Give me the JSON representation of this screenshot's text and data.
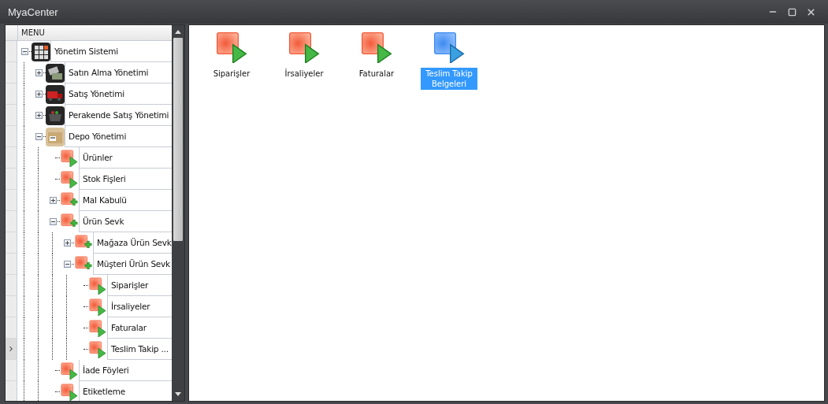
{
  "window": {
    "title": "MyaCenter"
  },
  "menu": {
    "header": "MENU",
    "items": [
      {
        "label": "Yönetim Sistemi",
        "kind": "grid",
        "expanded": true,
        "selected": false,
        "children": [
          {
            "label": "Satın Alma Yönetimi",
            "kind": "tags",
            "expanded": false,
            "selected": false
          },
          {
            "label": "Satış Yönetimi",
            "kind": "truck",
            "expanded": false,
            "selected": false
          },
          {
            "label": "Perakende Satış Yönetimi",
            "kind": "basket",
            "expanded": false,
            "selected": false
          },
          {
            "label": "Depo Yönetimi",
            "kind": "box",
            "expanded": true,
            "selected": false,
            "children": [
              {
                "label": "Ürünler",
                "kind": "play",
                "selected": false
              },
              {
                "label": "Stok Fişleri",
                "kind": "play",
                "selected": false
              },
              {
                "label": "Mal Kabulü",
                "kind": "plus",
                "expanded": false,
                "selected": false
              },
              {
                "label": "Ürün Sevk",
                "kind": "plus",
                "expanded": true,
                "selected": false,
                "children": [
                  {
                    "label": "Mağaza Ürün Sevk",
                    "kind": "plus",
                    "expanded": false,
                    "selected": false
                  },
                  {
                    "label": "Müşteri Ürün Sevk",
                    "kind": "plus",
                    "expanded": true,
                    "selected": false,
                    "children": [
                      {
                        "label": "Siparişler",
                        "kind": "play",
                        "selected": false
                      },
                      {
                        "label": "İrsaliyeler",
                        "kind": "play",
                        "selected": false
                      },
                      {
                        "label": "Faturalar",
                        "kind": "play",
                        "selected": false
                      },
                      {
                        "label": "Teslim Takip ...",
                        "kind": "play",
                        "selected": true
                      }
                    ]
                  }
                ]
              },
              {
                "label": "İade Föyleri",
                "kind": "play",
                "selected": false
              },
              {
                "label": "Etiketleme",
                "kind": "play",
                "selected": false
              }
            ]
          }
        ]
      }
    ]
  },
  "tiles": [
    {
      "label": "Siparişler",
      "selected": false
    },
    {
      "label": "İrsaliyeler",
      "selected": false
    },
    {
      "label": "Faturalar",
      "selected": false
    },
    {
      "label": "Teslim Takip Belgeleri",
      "selected": true
    }
  ]
}
